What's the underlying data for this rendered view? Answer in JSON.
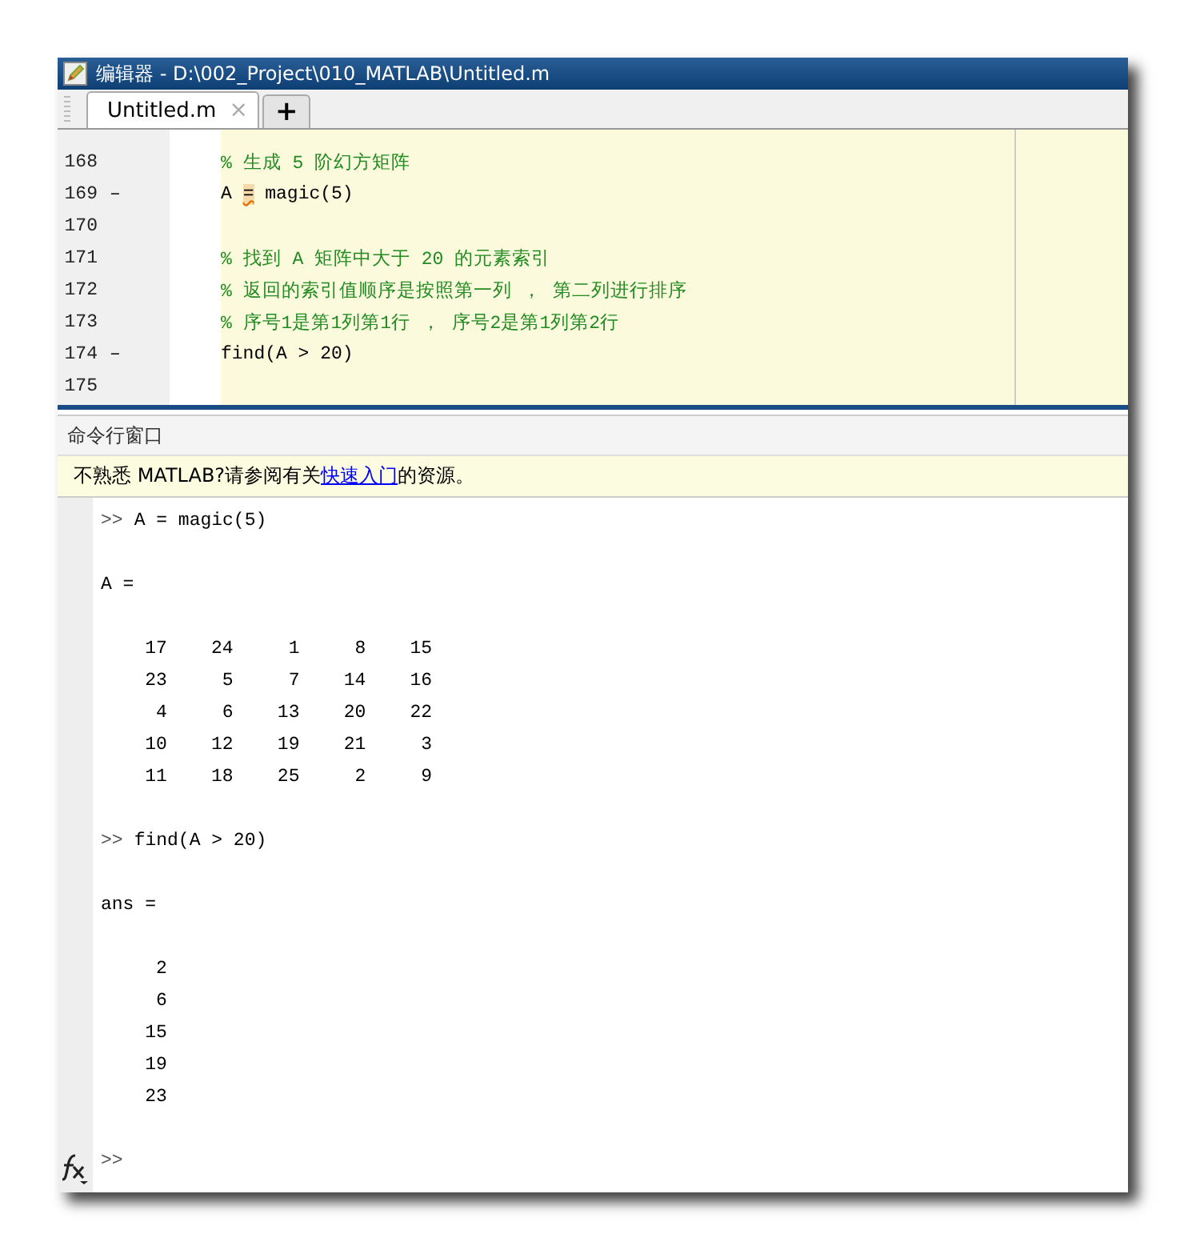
{
  "window": {
    "title": "编辑器 - D:\\002_Project\\010_MATLAB\\Untitled.m"
  },
  "tabs": [
    {
      "kind": "file",
      "label": "Untitled.m",
      "selected": true,
      "close": "×"
    },
    {
      "kind": "add",
      "label": "+",
      "selected": false
    }
  ],
  "editor": {
    "lines": [
      {
        "number": "168",
        "kind": "comment",
        "segments": [
          {
            "text": "% 生成 5 阶幻方矩阵"
          }
        ]
      },
      {
        "number": "169",
        "marker": "–",
        "kind": "code",
        "segments": [
          {
            "text": "A "
          },
          {
            "text": "=",
            "warning": true
          },
          {
            "text": " magic(5)"
          }
        ]
      },
      {
        "number": "170",
        "kind": "blank"
      },
      {
        "number": "171",
        "kind": "comment",
        "segments": [
          {
            "text": "% 找到 A 矩阵中大于 20 的元素索引"
          }
        ]
      },
      {
        "number": "172",
        "kind": "comment",
        "segments": [
          {
            "text": "% 返回的索引值顺序是按照第一列 ， 第二列进行排序"
          }
        ]
      },
      {
        "number": "173",
        "kind": "comment",
        "segments": [
          {
            "text": "% 序号1是第1列第1行 ， 序号2是第1列第2行"
          }
        ]
      },
      {
        "number": "174",
        "marker": "–",
        "kind": "code",
        "segments": [
          {
            "text": "find(A > 20)"
          }
        ]
      },
      {
        "number": "175",
        "kind": "blank"
      }
    ]
  },
  "command_window": {
    "title": "命令行窗口",
    "notice": {
      "before": "不熟悉 MATLAB?请参阅有关",
      "link": "快速入门",
      "after": "的资源。"
    },
    "lines": [
      {
        "kind": "prompt",
        "prompt": ">>",
        "text": "A = magic(5)"
      },
      {
        "kind": "blank"
      },
      {
        "kind": "output",
        "text": "A ="
      },
      {
        "kind": "blank"
      },
      {
        "kind": "output",
        "text": "    17    24     1     8    15"
      },
      {
        "kind": "output",
        "text": "    23     5     7    14    16"
      },
      {
        "kind": "output",
        "text": "     4     6    13    20    22"
      },
      {
        "kind": "output",
        "text": "    10    12    19    21     3"
      },
      {
        "kind": "output",
        "text": "    11    18    25     2     9"
      },
      {
        "kind": "blank"
      },
      {
        "kind": "prompt",
        "prompt": ">>",
        "text": "find(A > 20)"
      },
      {
        "kind": "blank"
      },
      {
        "kind": "output",
        "text": "ans ="
      },
      {
        "kind": "blank"
      },
      {
        "kind": "output",
        "text": "     2"
      },
      {
        "kind": "output",
        "text": "     6"
      },
      {
        "kind": "output",
        "text": "    15"
      },
      {
        "kind": "output",
        "text": "    19"
      },
      {
        "kind": "output",
        "text": "    23"
      },
      {
        "kind": "blank"
      }
    ],
    "input": {
      "prompt": ">>"
    }
  }
}
